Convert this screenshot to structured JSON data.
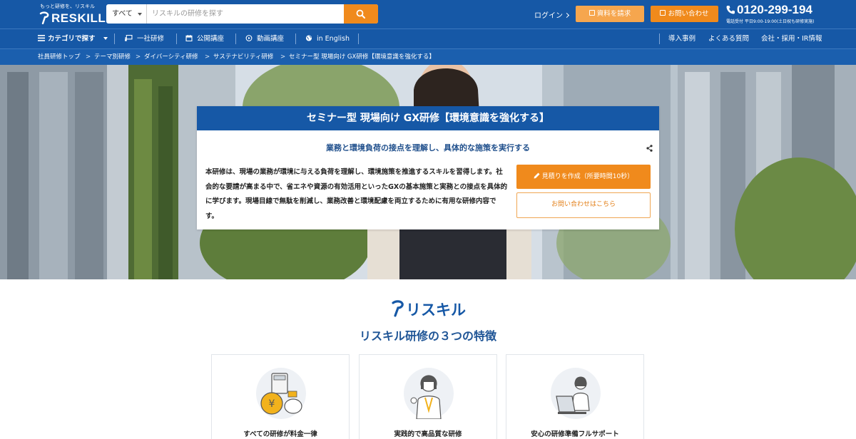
{
  "header": {
    "logo_tagline": "もっと研修を、リスキル",
    "logo_text": "RESKILL",
    "search": {
      "category": "すべて",
      "placeholder": "リスキルの研修を探す",
      "value": ""
    },
    "login": "ログイン",
    "docs_button": "資料を請求",
    "contact_button": "お問い合わせ",
    "phone_number": "0120-299-194",
    "phone_hours": "電話受付 平日9:00-19:00(土日祝も研修実施)"
  },
  "nav": {
    "category_menu": "カテゴリで探す",
    "items": [
      "一社研修",
      "公開講座",
      "動画講座",
      "in English"
    ],
    "right_items": [
      "導入事例",
      "よくある質問",
      "会社・採用・IR情報"
    ]
  },
  "breadcrumb": [
    "社員研修トップ",
    "テーマ別研修",
    "ダイバーシティ研修",
    "サステナビリティ研修",
    "セミナー型 現場向け GX研修【環境意識を強化する】"
  ],
  "breadcrumb_separator": ">",
  "hero": {
    "title": "セミナー型 現場向け GX研修【環境意識を強化する】",
    "subtitle": "業務と環境負荷の接点を理解し、具体的な施策を実行する",
    "description": "本研修は、現場の業務が環境に与える負荷を理解し、環境施策を推進するスキルを習得します。社会的な要請が高まる中で、省エネや資源の有効活用といったGXの基本施策と実務との接点を具体的に学びます。現場目線で無駄を削減し、業務改善と環境配慮を両立するために有用な研修内容です。",
    "cta_quote": "見積りを作成（所要時間10秒）",
    "cta_contact": "お問い合わせはこちら"
  },
  "brand": {
    "name": "リスキル",
    "section_title": "リスキル研修の３つの特徴"
  },
  "features": [
    {
      "label": "すべての研修が料金一律",
      "icon": "calculator-coin-pig-icon"
    },
    {
      "label": "実践的で高品質な研修",
      "icon": "instructor-ok-icon"
    },
    {
      "label": "安心の研修準備フルサポート",
      "icon": "support-laptop-icon"
    }
  ],
  "colors": {
    "primary": "#1658a6",
    "accent": "#f08a1c",
    "accent_light": "#f6a64e"
  }
}
